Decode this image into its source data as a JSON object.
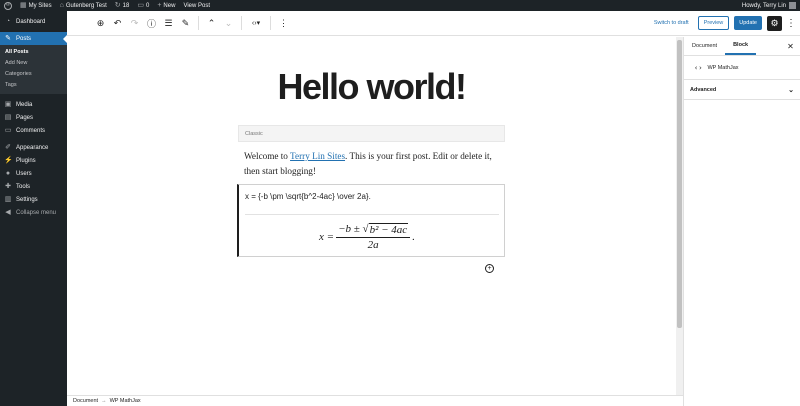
{
  "admin_bar": {
    "my_sites": "My Sites",
    "site_name": "Gutenberg Test",
    "updates_count": "18",
    "comments_count": "0",
    "new_label": "New",
    "view_post": "View Post",
    "howdy": "Howdy, Terry Lin"
  },
  "sidebar": {
    "dashboard": "Dashboard",
    "posts": "Posts",
    "posts_sub": [
      "All Posts",
      "Add New",
      "Categories",
      "Tags"
    ],
    "media": "Media",
    "pages": "Pages",
    "comments": "Comments",
    "appearance": "Appearance",
    "plugins": "Plugins",
    "users": "Users",
    "tools": "Tools",
    "settings": "Settings",
    "collapse": "Collapse menu"
  },
  "header": {
    "switch_to_draft": "Switch to draft",
    "preview": "Preview",
    "update": "Update"
  },
  "editor": {
    "title": "Hello world!",
    "classic_label": "Classic",
    "paragraph_before": "Welcome to ",
    "paragraph_link": "Terry Lin Sites",
    "paragraph_after": ". This is your first post. Edit or delete it, then start blogging!",
    "tex_source": "x = {-b \\pm \\sqrt{b^2-4ac} \\over 2a}.",
    "formula": {
      "lhs": "x =",
      "num_prefix": "−b ±",
      "radicand": "b² − 4ac",
      "den": "2a",
      "trailing": "."
    }
  },
  "settings_panel": {
    "tab_document": "Document",
    "tab_block": "Block",
    "block_name": "WP MathJax",
    "advanced": "Advanced"
  },
  "breadcrumb": {
    "root": "Document",
    "sep": "→",
    "current": "WP MathJax"
  },
  "colors": {
    "accent": "#2271b1",
    "admin_dark": "#1d2327",
    "submenu_dark": "#2c3338"
  }
}
